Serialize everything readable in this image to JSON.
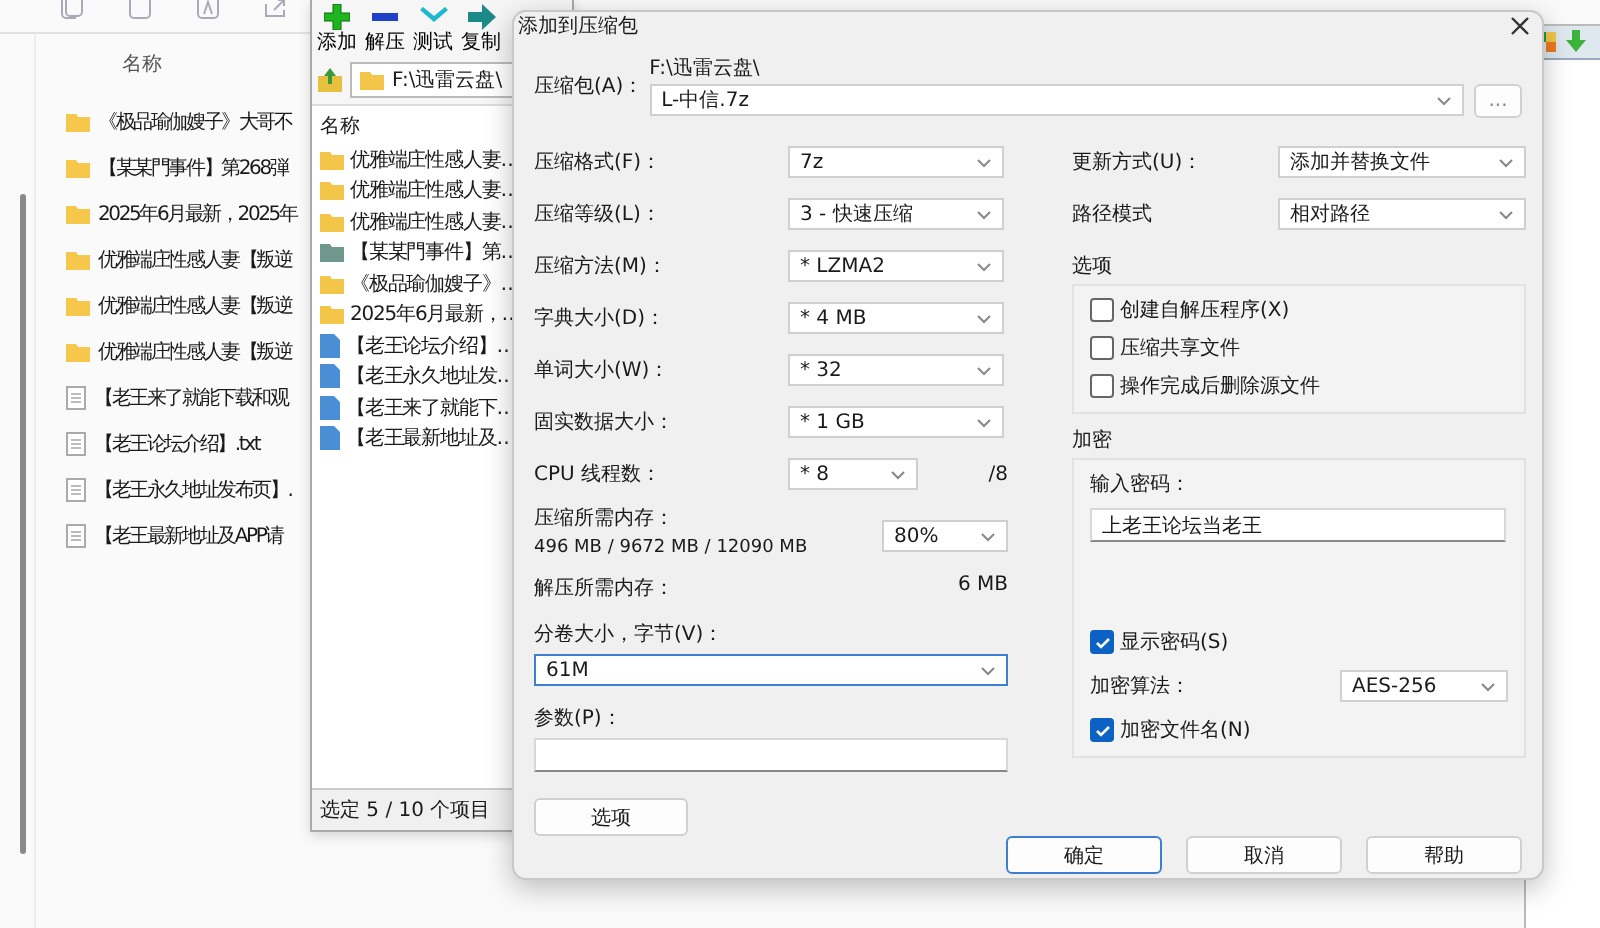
{
  "explorer": {
    "column": "名称",
    "rows": [
      {
        "kind": "folder",
        "name": "《极品瑜伽嫂子》大哥不"
      },
      {
        "kind": "folder",
        "name": "【某某門事件】第268弾"
      },
      {
        "kind": "folder",
        "name": "2025年6月最新，2025年"
      },
      {
        "kind": "folder",
        "name": "优雅端庄性感人妻【叛逆"
      },
      {
        "kind": "folder",
        "name": "优雅端庄性感人妻【叛逆"
      },
      {
        "kind": "folder",
        "name": "优雅端庄性感人妻【叛逆"
      },
      {
        "kind": "file",
        "name": "【老王来了就能下载和观"
      },
      {
        "kind": "file",
        "name": "【老王论坛介绍】.txt"
      },
      {
        "kind": "file",
        "name": "【老王永久地址发布页】."
      },
      {
        "kind": "file",
        "name": "【老王最新地址及APP请"
      }
    ]
  },
  "archiver": {
    "toolbar": [
      {
        "kind": "add",
        "label": "添加"
      },
      {
        "kind": "extract",
        "label": "解压"
      },
      {
        "kind": "test",
        "label": "测试"
      },
      {
        "kind": "copy",
        "label": "复制"
      }
    ],
    "path": "F:\\迅雷云盘\\",
    "column": "名称",
    "rows": [
      {
        "kind": "folder",
        "name": "优雅端庄性感人妻…"
      },
      {
        "kind": "folder",
        "name": "优雅端庄性感人妻…"
      },
      {
        "kind": "folder",
        "name": "优雅端庄性感人妻…"
      },
      {
        "kind": "folder-gray",
        "name": "【某某門事件】第…"
      },
      {
        "kind": "folder",
        "name": "《极品瑜伽嫂子》…"
      },
      {
        "kind": "folder",
        "name": "2025年6月最新，…"
      },
      {
        "kind": "file",
        "name": "【老王论坛介绍】…"
      },
      {
        "kind": "file",
        "name": "【老王永久地址发…"
      },
      {
        "kind": "file",
        "name": "【老王来了就能下…"
      },
      {
        "kind": "file",
        "name": "【老王最新地址及…"
      }
    ],
    "status": "选定 5 / 10 个项目"
  },
  "dialog": {
    "title": "添加到压缩包",
    "archive": {
      "label": "压缩包(A)：",
      "folder": "F:\\迅雷云盘\\",
      "value": "L-中信.7z",
      "browse": "..."
    },
    "settings": [
      {
        "kind": "select",
        "label": "压缩格式(F)：",
        "value": "7z"
      },
      {
        "kind": "select",
        "label": "压缩等级(L)：",
        "value": "3 - 快速压缩"
      },
      {
        "kind": "select",
        "label": "压缩方法(M)：",
        "value": "* LZMA2"
      },
      {
        "kind": "select",
        "label": "字典大小(D)：",
        "value": "* 4 MB"
      },
      {
        "kind": "select",
        "label": "单词大小(W)：",
        "value": "* 32"
      },
      {
        "kind": "select",
        "label": "固实数据大小：",
        "value": "* 1 GB"
      },
      {
        "kind": "threads",
        "label": "CPU 线程数：",
        "value": "* 8",
        "note": "/8"
      },
      {
        "kind": "memory",
        "label": "压缩所需内存：",
        "detail": "496 MB / 9672 MB / 12090 MB",
        "value": "80%"
      },
      {
        "kind": "info",
        "label": "解压所需内存：",
        "value": "6 MB"
      }
    ],
    "volume": {
      "label": "分卷大小，字节(V)：",
      "value": "61M"
    },
    "params": {
      "label": "参数(P)："
    },
    "options_button": "选项",
    "update": {
      "label": "更新方式(U)：",
      "value": "添加并替换文件"
    },
    "path_mode": {
      "label": "路径模式",
      "value": "相对路径"
    },
    "options_group": {
      "title": "选项",
      "checks": [
        {
          "label": "创建自解压程序(X)",
          "checked": false
        },
        {
          "label": "压缩共享文件",
          "checked": false
        },
        {
          "label": "操作完成后删除源文件",
          "checked": false
        }
      ]
    },
    "encryption": {
      "title": "加密",
      "password_label": "输入密码：",
      "password": "上老王论坛当老王",
      "show_password": {
        "label": "显示密码(S)",
        "checked": true
      },
      "method_label": "加密算法：",
      "method": "AES-256",
      "encrypt_names": {
        "label": "加密文件名(N)",
        "checked": true
      }
    },
    "buttons": [
      {
        "label": "确定",
        "default": true
      },
      {
        "label": "取消",
        "default": false
      },
      {
        "label": "帮助",
        "default": false
      }
    ]
  }
}
